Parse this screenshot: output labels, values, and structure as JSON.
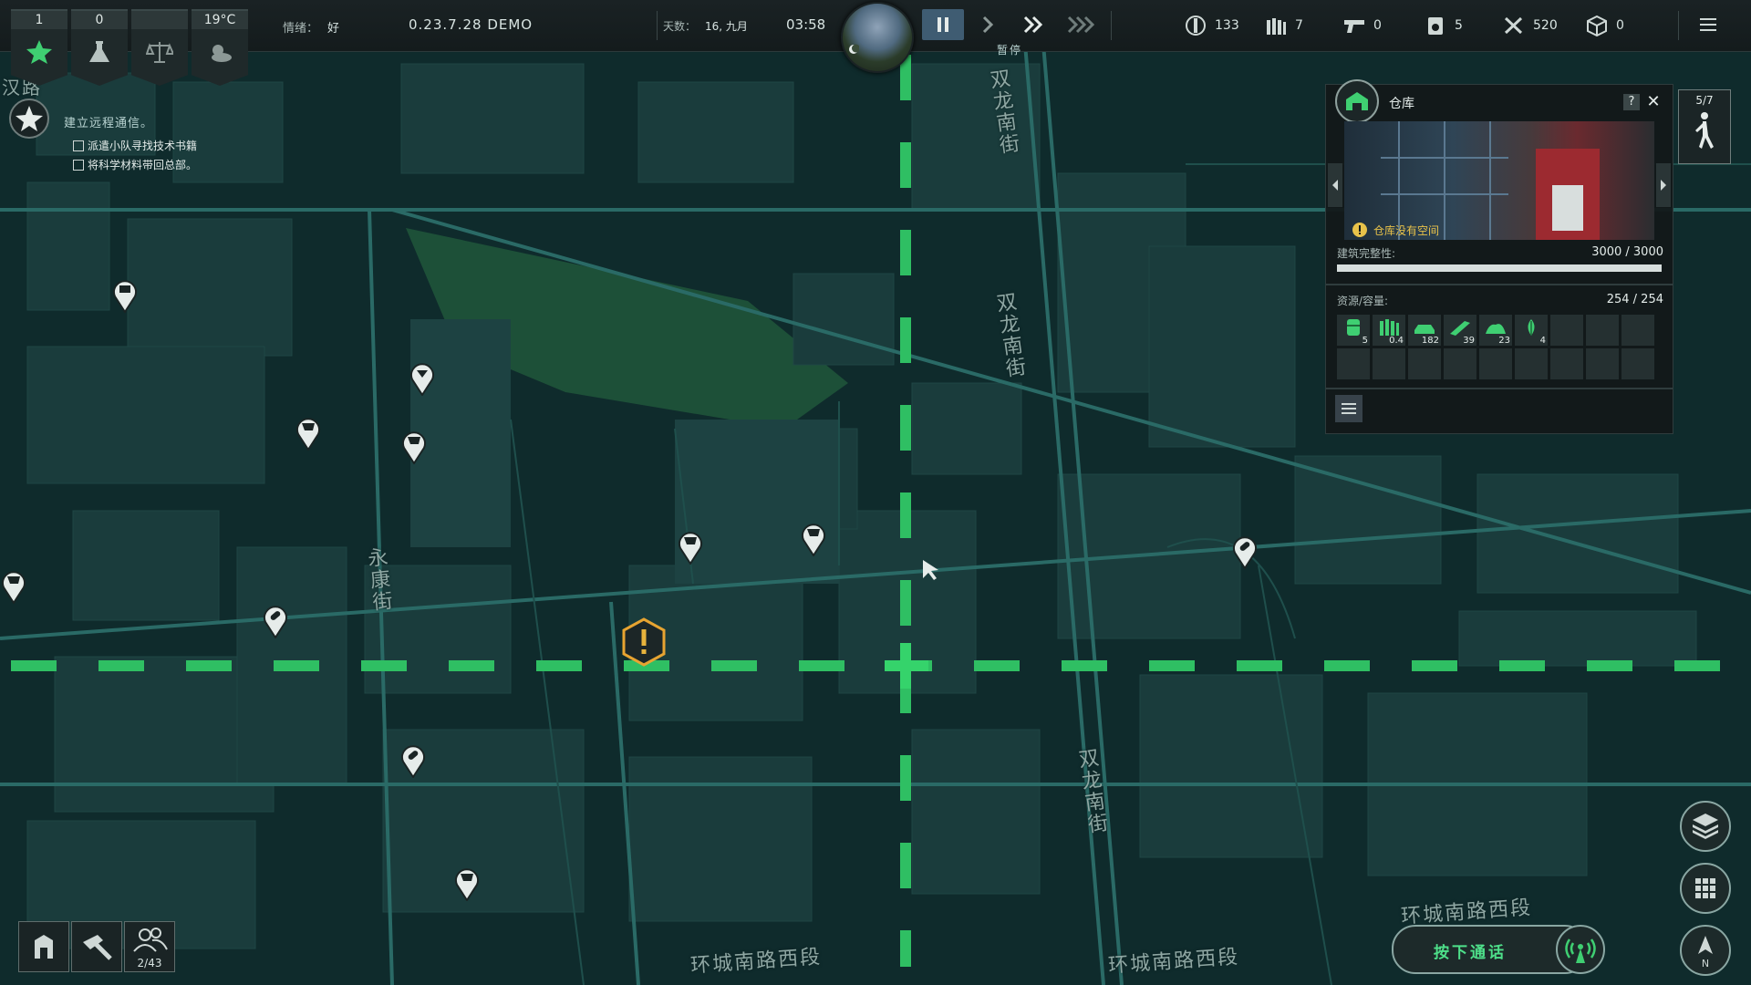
{
  "topbar": {
    "stats": [
      {
        "value": "1",
        "icon": "star-icon"
      },
      {
        "value": "0",
        "icon": "flask-icon"
      },
      {
        "value": "",
        "icon": "scales-icon"
      },
      {
        "value": "19°C",
        "icon": "weather-icon"
      }
    ],
    "mood_label": "情绪：",
    "mood_value": "好",
    "version": "0.23.7.28 DEMO",
    "day_label": "天数：",
    "day_value": "16, 九月",
    "time": "03:58",
    "paused_label": "暂停",
    "resources": [
      {
        "icon": "parts-icon",
        "value": "133"
      },
      {
        "icon": "ammo-icon",
        "value": "7"
      },
      {
        "icon": "gun-icon",
        "value": "0"
      },
      {
        "icon": "fuel-icon",
        "value": "5"
      },
      {
        "icon": "tools-icon",
        "value": "520"
      },
      {
        "icon": "crate-icon",
        "value": "0"
      }
    ]
  },
  "quest": {
    "title": "建立远程通信。",
    "items": [
      "派遣小队寻找技术书籍",
      "将科学材料带回总部。"
    ]
  },
  "panel": {
    "title": "仓库",
    "help": "?",
    "close": "✕",
    "warning": "仓库没有空间",
    "integrity_label": "建筑完整性:",
    "integrity_value": "3000 / 3000",
    "integrity_ratio": 1.0,
    "storage_label": "资源/容量:",
    "storage_value": "254 / 254",
    "slots": [
      {
        "icon": "barrel-icon",
        "count": "5"
      },
      {
        "icon": "ammo-box-icon",
        "count": "0.4"
      },
      {
        "icon": "car-parts-icon",
        "count": "182"
      },
      {
        "icon": "planks-icon",
        "count": "39"
      },
      {
        "icon": "scrap-icon",
        "count": "23"
      },
      {
        "icon": "herb-icon",
        "count": "4"
      }
    ],
    "squad_count": "5/7"
  },
  "streets": {
    "yongkang": "永康街",
    "shuanglong": "双龙南街",
    "huancheng": "环城南路西段",
    "corner": "汉路"
  },
  "bottom_left": {
    "survivors": "2/43"
  },
  "bottom_right": {
    "talk_label": "按下通话",
    "compass_label": "N"
  },
  "colors": {
    "accent_green": "#3fcf72",
    "warning": "#e8c24a",
    "map_bg": "#0e2a2b"
  }
}
